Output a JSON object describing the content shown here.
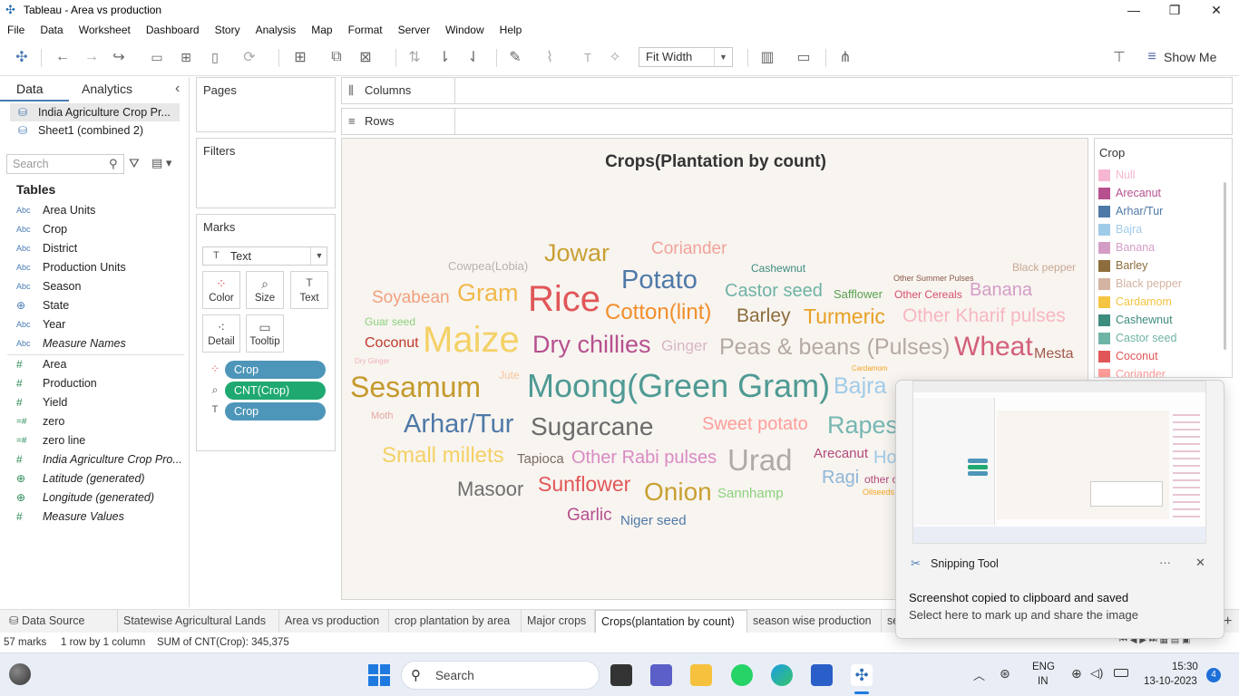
{
  "window": {
    "title": "Tableau - Area vs production",
    "minimize": "—",
    "restore": "❐",
    "close": "✕"
  },
  "menu": [
    "File",
    "Data",
    "Worksheet",
    "Dashboard",
    "Story",
    "Analysis",
    "Map",
    "Format",
    "Server",
    "Window",
    "Help"
  ],
  "toolbar": {
    "fit_value": "Fit Width",
    "show_me": "Show Me"
  },
  "data_pane": {
    "tab_data": "Data",
    "tab_analytics": "Analytics",
    "collapse": "‹",
    "sources": [
      {
        "name": "India Agriculture Crop Pr...",
        "selected": true
      },
      {
        "name": "Sheet1 (combined 2)",
        "selected": false
      }
    ],
    "search_placeholder": "Search",
    "tables_header": "Tables",
    "dimensions": [
      {
        "type": "Abc",
        "name": "Area Units"
      },
      {
        "type": "Abc",
        "name": "Crop"
      },
      {
        "type": "Abc",
        "name": "District"
      },
      {
        "type": "Abc",
        "name": "Production Units"
      },
      {
        "type": "Abc",
        "name": "Season"
      },
      {
        "type": "globe",
        "name": "State"
      },
      {
        "type": "Abc",
        "name": "Year"
      },
      {
        "type": "Abc",
        "name": "Measure Names",
        "italic": true
      }
    ],
    "measures": [
      {
        "type": "#",
        "name": "Area"
      },
      {
        "type": "#",
        "name": "Production"
      },
      {
        "type": "#",
        "name": "Yield"
      },
      {
        "type": "=#",
        "name": "zero"
      },
      {
        "type": "=#",
        "name": "zero line"
      },
      {
        "type": "#",
        "name": "India Agriculture Crop Pro...",
        "italic": true
      },
      {
        "type": "globe",
        "name": "Latitude (generated)",
        "italic": true
      },
      {
        "type": "globe",
        "name": "Longitude (generated)",
        "italic": true
      },
      {
        "type": "#",
        "name": "Measure Values",
        "italic": true
      }
    ]
  },
  "shelves": {
    "pages": "Pages",
    "filters": "Filters",
    "columns": "Columns",
    "rows": "Rows",
    "marks": "Marks",
    "mark_type": "Text",
    "mark_buttons": [
      "Color",
      "Size",
      "Text",
      "Detail",
      "Tooltip"
    ],
    "pills": [
      {
        "icon": "color-icon",
        "label": "Crop",
        "color": "#4e96b9"
      },
      {
        "icon": "size-icon",
        "label": "CNT(Crop)",
        "color": "#1fa971"
      },
      {
        "icon": "text-icon",
        "label": "Crop",
        "color": "#4e96b9"
      }
    ]
  },
  "viz": {
    "title": "Crops(Plantation by count)",
    "words": [
      {
        "t": "Jowar",
        "c": "#c8a032",
        "s": 27
      },
      {
        "t": "Coriander",
        "c": "#f0a39a",
        "s": 19
      },
      {
        "t": "Cowpea(Lobia)",
        "c": "#b8b0b0",
        "s": 13
      },
      {
        "t": "Potato",
        "c": "#4e79a7",
        "s": 29
      },
      {
        "t": "Cashewnut",
        "c": "#3e8c7e",
        "s": 12
      },
      {
        "t": "Black pepper",
        "c": "#c9a894",
        "s": 12
      },
      {
        "t": "Other Summer Pulses",
        "c": "#8a5a4a",
        "s": 9
      },
      {
        "t": "Soyabean",
        "c": "#f2a07e",
        "s": 19
      },
      {
        "t": "Gram",
        "c": "#f1b84a",
        "s": 27
      },
      {
        "t": "Rice",
        "c": "#e15759",
        "s": 40
      },
      {
        "t": "Castor seed",
        "c": "#6fb3a6",
        "s": 20
      },
      {
        "t": "Safflower",
        "c": "#59a14f",
        "s": 13
      },
      {
        "t": "Other Cereals",
        "c": "#d6506a",
        "s": 12
      },
      {
        "t": "Banana",
        "c": "#d49dc6",
        "s": 20
      },
      {
        "t": "Guar seed",
        "c": "#8cd17d",
        "s": 12
      },
      {
        "t": "Maize",
        "c": "#f4d166",
        "s": 40
      },
      {
        "t": "Cotton(lint)",
        "c": "#f28e2b",
        "s": 24
      },
      {
        "t": "Barley",
        "c": "#8c6d3b",
        "s": 21
      },
      {
        "t": "Turmeric",
        "c": "#e8a024",
        "s": 23
      },
      {
        "t": "Other Kharif pulses",
        "c": "#f7b6c2",
        "s": 21
      },
      {
        "t": "Coconut",
        "c": "#c0392b",
        "s": 16
      },
      {
        "t": "Dry chillies",
        "c": "#b6508f",
        "s": 27
      },
      {
        "t": "Ginger",
        "c": "#d8b7c6",
        "s": 17
      },
      {
        "t": "Peas & beans (Pulses)",
        "c": "#b5a9a4",
        "s": 25
      },
      {
        "t": "Wheat",
        "c": "#d3607a",
        "s": 30
      },
      {
        "t": "Mesta",
        "c": "#a05a4a",
        "s": 16
      },
      {
        "t": "Dry Ginger",
        "c": "#f0b0b8",
        "s": 8
      },
      {
        "t": "Cardamom",
        "c": "#f5a623",
        "s": 8
      },
      {
        "t": "Jute",
        "c": "#f7c79b",
        "s": 12
      },
      {
        "t": "Sesamum",
        "c": "#c49a2c",
        "s": 32
      },
      {
        "t": "Moong(Green Gram)",
        "c": "#4f9a94",
        "s": 36
      },
      {
        "t": "Bajra",
        "c": "#a0cbe8",
        "s": 25
      },
      {
        "t": "Moth",
        "c": "#e5a9a0",
        "s": 11
      },
      {
        "t": "Arhar/Tur",
        "c": "#4e79a7",
        "s": 29
      },
      {
        "t": "Sugarcane",
        "c": "#6b6b6b",
        "s": 28
      },
      {
        "t": "Sweet potato",
        "c": "#ff9d9a",
        "s": 20
      },
      {
        "t": "Rapes",
        "c": "#76b7b2",
        "s": 27
      },
      {
        "t": "Small millets",
        "c": "#f4d166",
        "s": 24
      },
      {
        "t": "Tapioca",
        "c": "#7a6a64",
        "s": 15
      },
      {
        "t": "Other Rabi pulses",
        "c": "#d98ac3",
        "s": 20
      },
      {
        "t": "Urad",
        "c": "#b0aaa6",
        "s": 33
      },
      {
        "t": "Arecanut",
        "c": "#b04a7a",
        "s": 15
      },
      {
        "t": "Ho",
        "c": "#a0cbe8",
        "s": 20
      },
      {
        "t": "Ragi",
        "c": "#8fb6d8",
        "s": 20
      },
      {
        "t": "other o",
        "c": "#b04a7a",
        "s": 12
      },
      {
        "t": "Oilseeds",
        "c": "#f5a623",
        "s": 9
      },
      {
        "t": "Masoor",
        "c": "#6f6f6f",
        "s": 22
      },
      {
        "t": "Sunflower",
        "c": "#e15759",
        "s": 23
      },
      {
        "t": "Onion",
        "c": "#c8a032",
        "s": 28
      },
      {
        "t": "Sannhamp",
        "c": "#8cd17d",
        "s": 15
      },
      {
        "t": "Garlic",
        "c": "#b6508f",
        "s": 19
      },
      {
        "t": "Niger seed",
        "c": "#4e79a7",
        "s": 15
      }
    ]
  },
  "legend": {
    "title": "Crop",
    "items": [
      {
        "label": "Null",
        "color": "#f7b6d2"
      },
      {
        "label": "Arecanut",
        "color": "#b6508f"
      },
      {
        "label": "Arhar/Tur",
        "color": "#4e79a7"
      },
      {
        "label": "Bajra",
        "color": "#a0cbe8"
      },
      {
        "label": "Banana",
        "color": "#d49dc6"
      },
      {
        "label": "Barley",
        "color": "#8c6d3b"
      },
      {
        "label": "Black pepper",
        "color": "#d4b3a2"
      },
      {
        "label": "Cardamom",
        "color": "#f4c542"
      },
      {
        "label": "Cashewnut",
        "color": "#3e8c7e"
      },
      {
        "label": "Castor seed",
        "color": "#6fb3a6"
      },
      {
        "label": "Coconut",
        "color": "#e15759"
      },
      {
        "label": "Coriander",
        "color": "#ff9d9a"
      }
    ]
  },
  "sheet_tabs": [
    {
      "label": "Data Source",
      "active": false
    },
    {
      "label": "Statewise Agricultural Lands",
      "active": false
    },
    {
      "label": "Area vs production",
      "active": false
    },
    {
      "label": "crop plantation by area",
      "active": false
    },
    {
      "label": "Major crops",
      "active": false
    },
    {
      "label": "Crops(plantation by count)",
      "active": true
    },
    {
      "label": "season wise production",
      "active": false
    },
    {
      "label": "se",
      "active": false
    }
  ],
  "status": {
    "marks": "57 marks",
    "dims": "1 row by 1 column",
    "sum": "SUM of CNT(Crop): 345,375"
  },
  "toast": {
    "app": "Snipping Tool",
    "more": "···",
    "close": "✕",
    "line1": "Screenshot copied to clipboard and saved",
    "line2": "Select here to mark up and share the image"
  },
  "taskbar": {
    "search": "Search",
    "lang1": "ENG",
    "lang2": "IN",
    "time": "15:30",
    "date": "13-10-2023",
    "notif": "4"
  }
}
